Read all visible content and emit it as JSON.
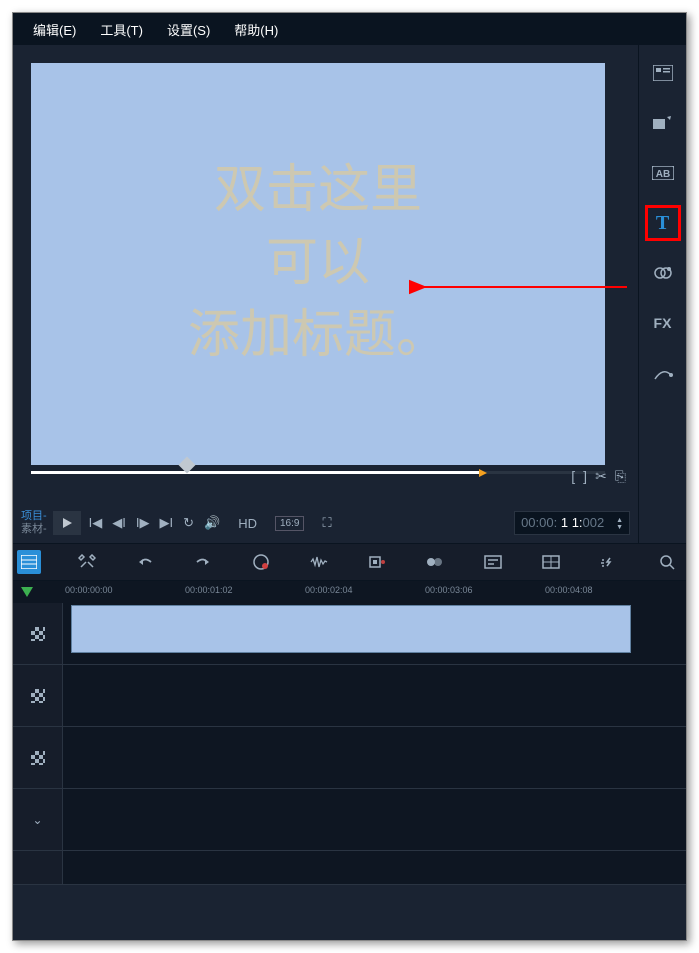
{
  "menubar": {
    "edit": "编辑(E)",
    "tools": "工具(T)",
    "settings": "设置(S)",
    "help": "帮助(H)"
  },
  "preview": {
    "line1": "双击这里",
    "line2": "可以",
    "line3": "添加标题。"
  },
  "sidebar": {
    "fx_label": "FX",
    "title_label": "T",
    "ab_label": "AB"
  },
  "playback": {
    "mode_project": "项目-",
    "mode_clip": "素材-",
    "hd": "HD",
    "aspect": "16:9"
  },
  "timecode": {
    "hours": "00:",
    "minutes": "00:",
    "seconds": " 1 1:",
    "frames": "002"
  },
  "ruler": {
    "t0": "00:00:00:00",
    "t1": "00:00:01:02",
    "t2": "00:00:02:04",
    "t3": "00:00:03:06",
    "t4": "00:00:04:08"
  }
}
